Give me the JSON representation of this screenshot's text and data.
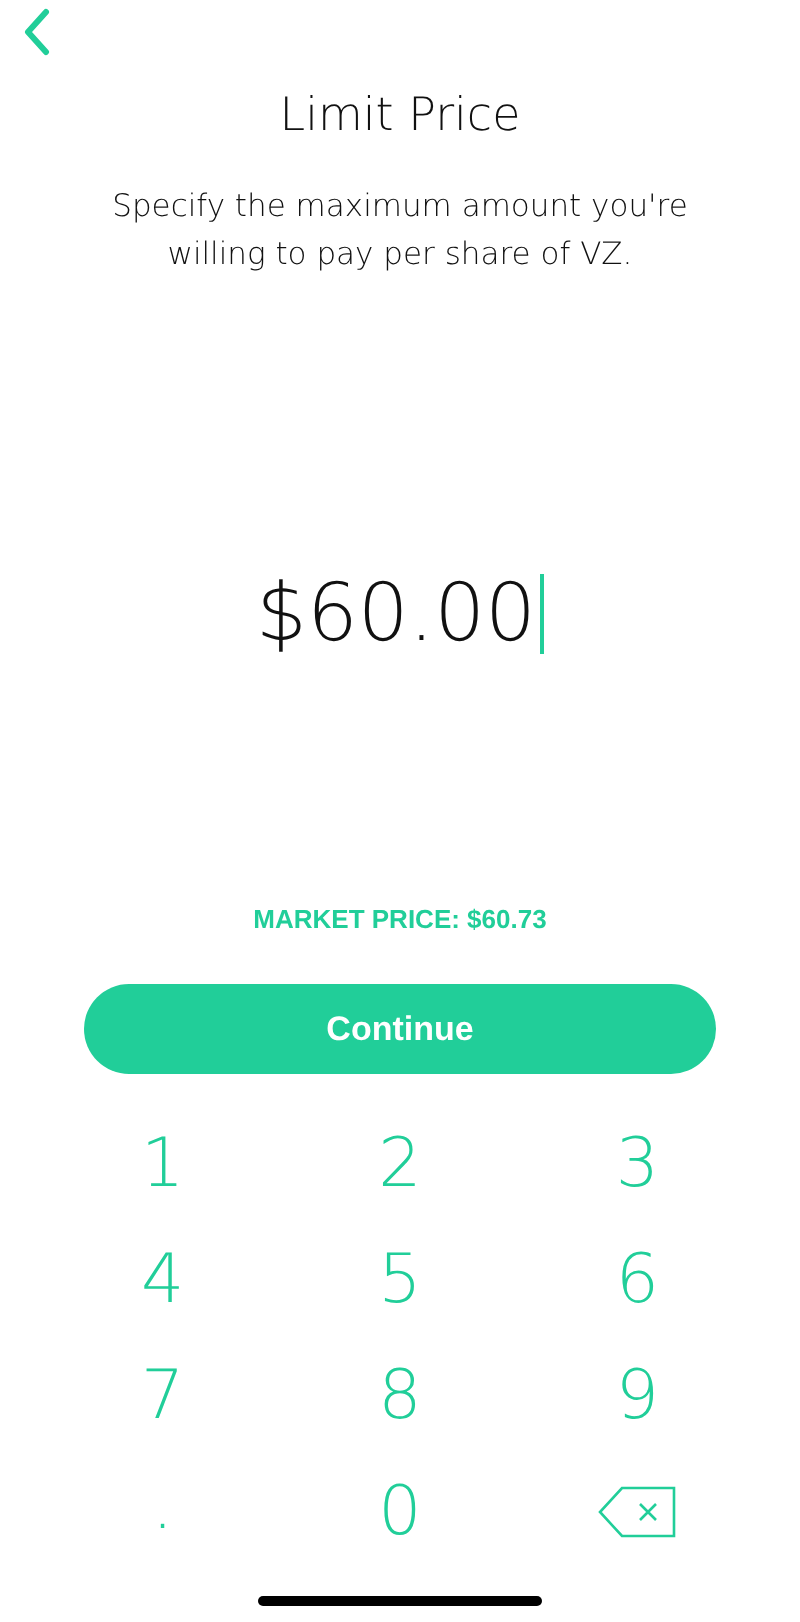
{
  "header": {
    "title": "Limit Price",
    "description": "Specify the maximum amount you're willing to pay per share of VZ."
  },
  "amount": {
    "value": "$60.00"
  },
  "market_price": "MARKET PRICE: $60.73",
  "continue_button": {
    "label": "Continue"
  },
  "keypad": [
    {
      "kind": "digit",
      "label": "1"
    },
    {
      "kind": "digit",
      "label": "2"
    },
    {
      "kind": "digit",
      "label": "3"
    },
    {
      "kind": "digit",
      "label": "4"
    },
    {
      "kind": "digit",
      "label": "5"
    },
    {
      "kind": "digit",
      "label": "6"
    },
    {
      "kind": "digit",
      "label": "7"
    },
    {
      "kind": "digit",
      "label": "8"
    },
    {
      "kind": "digit",
      "label": "9"
    },
    {
      "kind": "decimal",
      "label": "."
    },
    {
      "kind": "digit",
      "label": "0"
    },
    {
      "kind": "backspace"
    }
  ]
}
